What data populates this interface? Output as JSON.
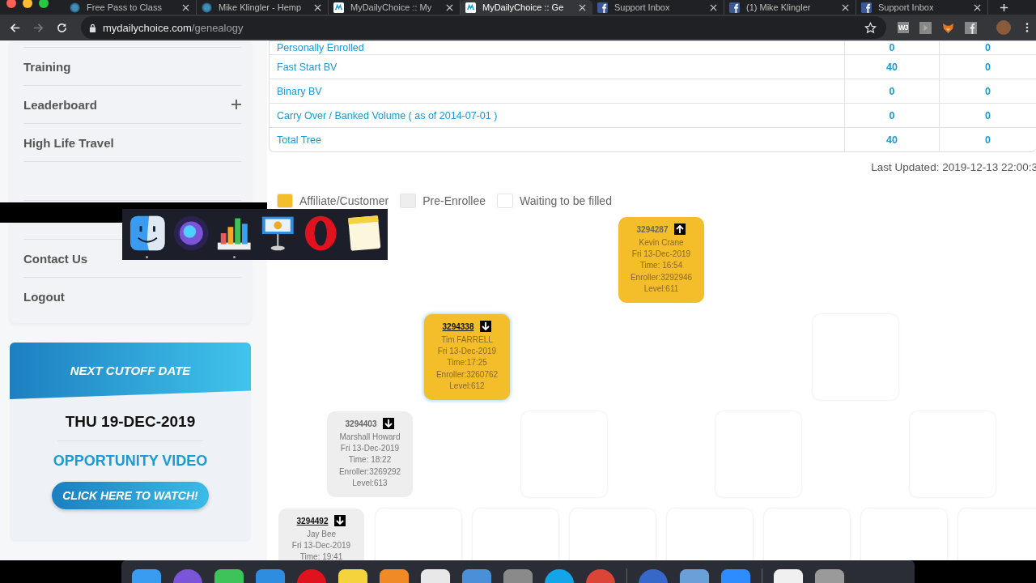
{
  "browser": {
    "tabs": [
      {
        "title": "Free Pass to Class",
        "kind": "ps",
        "selected": false
      },
      {
        "title": "Mike Klingler - Hemp",
        "kind": "ps",
        "selected": false
      },
      {
        "title": "MyDailyChoice :: My",
        "kind": "mdc",
        "selected": false
      },
      {
        "title": "MyDailyChoice :: Ge",
        "kind": "mdc",
        "selected": true
      },
      {
        "title": "Support Inbox",
        "kind": "facebook",
        "selected": false
      },
      {
        "title": "(1) Mike Klingler",
        "kind": "facebook",
        "selected": false
      },
      {
        "title": "Support Inbox",
        "kind": "facebook",
        "selected": false
      }
    ],
    "url_host": "mydailychoice.com",
    "url_path": "/genealogy",
    "extension_label": "WJ"
  },
  "sidebar": {
    "items": [
      {
        "label": "Training",
        "expandable": false
      },
      {
        "label": "Leaderboard",
        "expandable": true
      },
      {
        "label": "High Life Travel",
        "expandable": false
      },
      {
        "label": "Contact Us",
        "expandable": false
      },
      {
        "label": "Logout",
        "expandable": false
      }
    ]
  },
  "cutoff": {
    "heading": "NEXT CUTOFF DATE",
    "date": "THU 19-DEC-2019",
    "video_heading": "OPPORTUNITY VIDEO",
    "button": "CLICK HERE TO WATCH!"
  },
  "volume_table": {
    "rows": [
      {
        "label": "Personally Enrolled",
        "column_2": "0",
        "column_3": "0"
      },
      {
        "label": "Fast Start BV",
        "column_2": "40",
        "column_3": "0"
      },
      {
        "label": "Binary BV",
        "column_2": "0",
        "column_3": "0"
      },
      {
        "label": "Carry Over / Banked Volume ( as of 2014-07-01 )",
        "column_2": "0",
        "column_3": "0"
      },
      {
        "label": "Total Tree",
        "column_2": "40",
        "column_3": "0"
      }
    ]
  },
  "last_updated": "Last Updated: 2019-12-13 22:00:3",
  "legend": [
    {
      "label": "Affiliate/Customer",
      "color": "#f4bd2a"
    },
    {
      "label": "Pre-Enrollee",
      "color": "#eeeeee"
    },
    {
      "label": "Waiting to be filled",
      "color": "#ffffff"
    }
  ],
  "tree": {
    "kind": "affiliate",
    "id": "3294287",
    "arrow_up": true,
    "linked": false,
    "selected": false,
    "lines": [
      "Kevin Crane",
      "Fri 13-Dec-2019",
      "Time: 16:54",
      "Enroller:3292946",
      "Level:611"
    ],
    "children": [
      {
        "kind": "affiliate",
        "id": "3294338",
        "arrow_up": false,
        "linked": true,
        "selected": true,
        "lines": [
          "Tim FARRELL",
          "Fri 13-Dec-2019",
          "Time:17:25",
          "Enroller:3260762",
          "Level:612"
        ],
        "children": [
          {
            "kind": "pre-enrollee",
            "id": "3294403",
            "arrow_up": false,
            "linked": false,
            "selected": false,
            "lines": [
              "Marshall Howard",
              "Fri 13-Dec-2019",
              "Time: 18:22",
              "Enroller:3269292",
              "Level:613"
            ],
            "children": [
              {
                "kind": "pre-enrollee",
                "id": "3294492",
                "arrow_up": false,
                "linked": true,
                "selected": false,
                "lines": [
                  "Jay Bee",
                  "Fri 13-Dec-2019",
                  "Time: 19:41"
                ]
              },
              {
                "kind": "empty"
              }
            ]
          },
          {
            "kind": "empty",
            "children": [
              {
                "kind": "empty"
              },
              {
                "kind": "empty"
              }
            ]
          }
        ]
      },
      {
        "kind": "empty",
        "children": [
          {
            "kind": "empty",
            "children": [
              {
                "kind": "empty"
              },
              {
                "kind": "empty"
              }
            ]
          },
          {
            "kind": "empty",
            "children": [
              {
                "kind": "empty"
              },
              {
                "kind": "empty"
              }
            ]
          }
        ]
      }
    ]
  }
}
